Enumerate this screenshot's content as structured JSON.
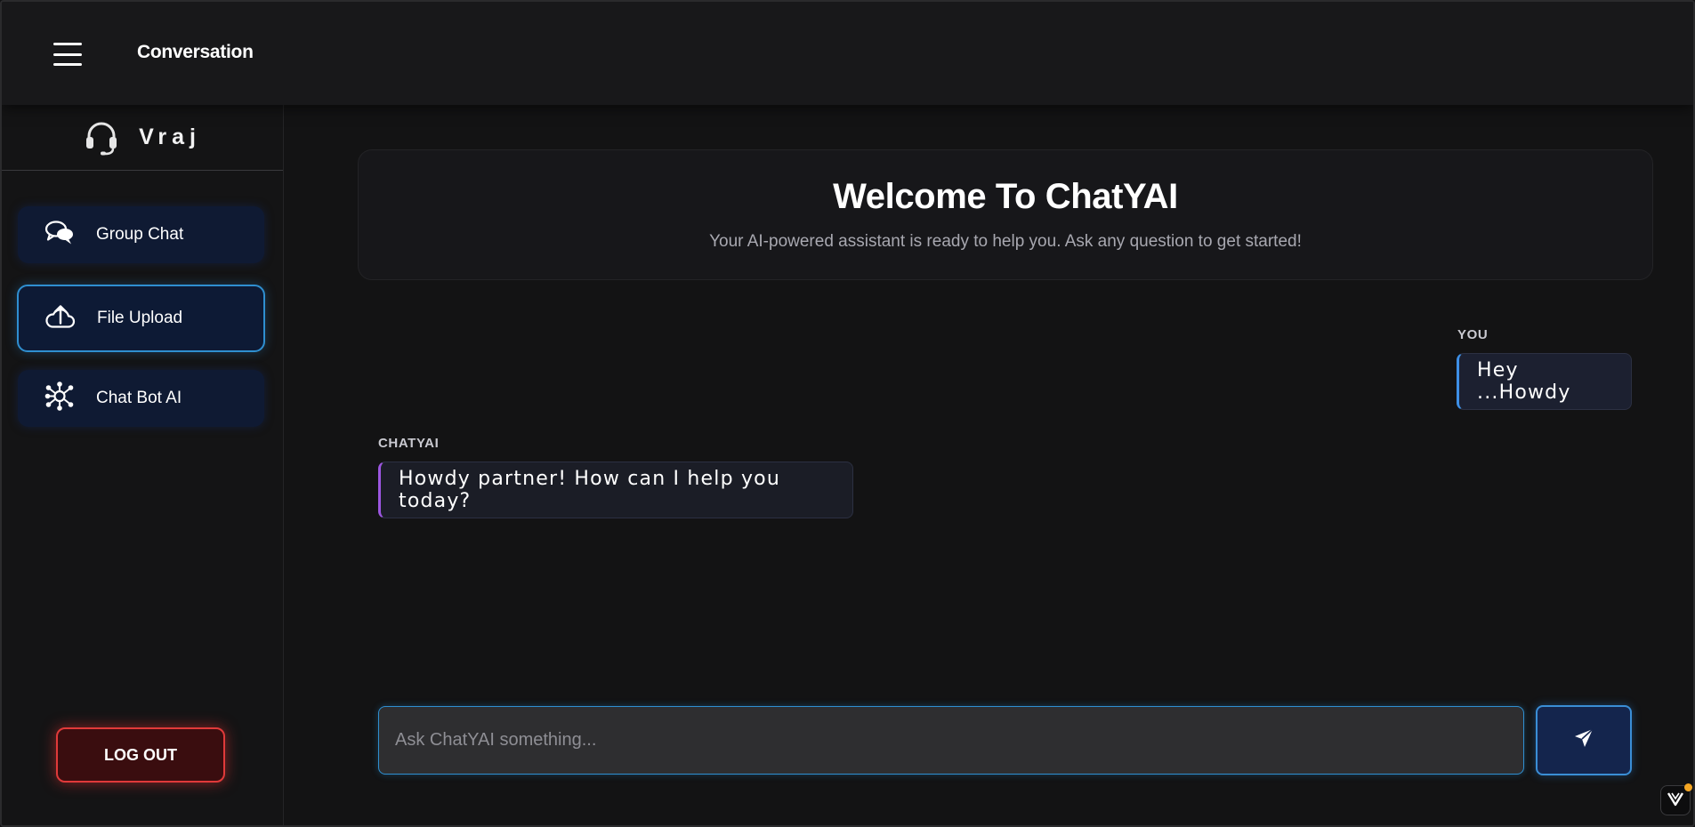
{
  "topbar": {
    "title": "Conversation",
    "menu_icon": "hamburger-menu-icon"
  },
  "sidebar": {
    "user_name": "Vraj",
    "user_icon": "headset-icon",
    "items": [
      {
        "label": "Group Chat",
        "icon": "chat-bubbles-icon",
        "active": false
      },
      {
        "label": "File Upload",
        "icon": "cloud-upload-icon",
        "active": true
      },
      {
        "label": "Chat Bot AI",
        "icon": "network-nodes-icon",
        "active": false
      }
    ],
    "logout_label": "LOG OUT"
  },
  "welcome": {
    "title": "Welcome To ChatYAI",
    "subtitle": "Your AI-powered assistant is ready to help you. Ask any question to get started!"
  },
  "messages": [
    {
      "sender": "YOU",
      "text": "Hey ...Howdy",
      "role": "user"
    },
    {
      "sender": "CHATYAI",
      "text": "Howdy partner! How can I help you today?",
      "role": "ai"
    }
  ],
  "composer": {
    "placeholder": "Ask ChatYAI something...",
    "value": "",
    "send_icon": "paper-plane-icon"
  },
  "colors": {
    "accent_blue": "#2f8fd0",
    "logout_red": "#e03a3a",
    "ai_accent": "#9c56e0",
    "user_accent": "#3d8fe6"
  }
}
